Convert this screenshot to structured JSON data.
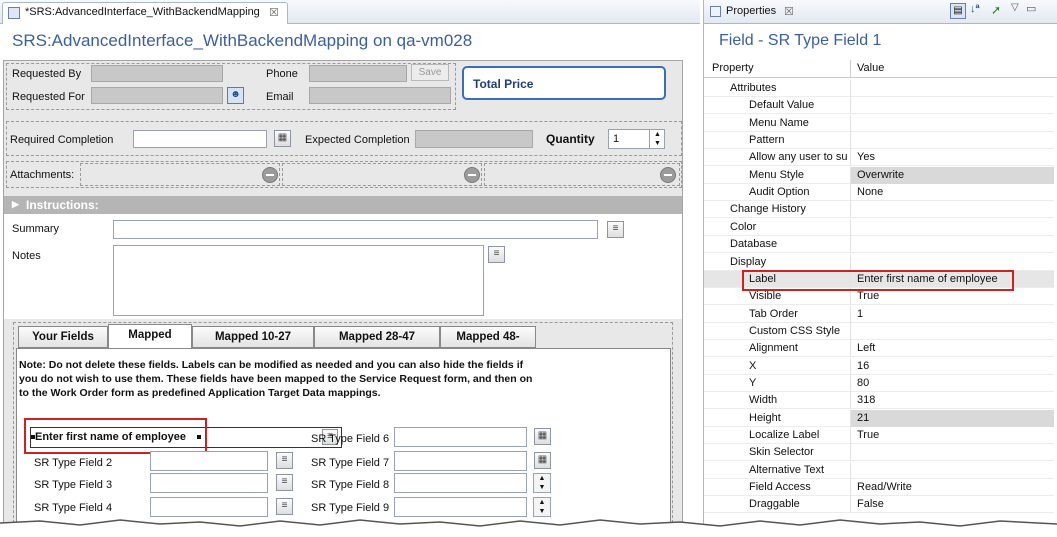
{
  "editor": {
    "tab_title": "*SRS:AdvancedInterface_WithBackendMapping",
    "page_title": "SRS:AdvancedInterface_WithBackendMapping on qa-vm028"
  },
  "form": {
    "requested_by_label": "Requested By",
    "requested_for_label": "Requested For",
    "phone_label": "Phone",
    "email_label": "Email",
    "save_label": "Save",
    "total_price_label": "Total Price",
    "required_completion_label": "Required Completion",
    "expected_completion_label": "Expected Completion",
    "quantity_label": "Quantity",
    "quantity_value": "1",
    "attachments_label": "Attachments:",
    "instructions_label": "Instructions:",
    "summary_label": "Summary",
    "notes_label": "Notes",
    "tabs": [
      "Your Fields",
      "Mapped",
      "Mapped 10-27",
      "Mapped 28-47",
      "Mapped 48-"
    ],
    "note": "Note: Do not delete these fields. Labels can be modified as needed and you can also hide the fields if you do not wish to use them.  These fields have been mapped to the Service Request form, and then on to the Work Order form as predefined Application Target Data mappings.",
    "selected_field_label": "Enter first name of employee",
    "left_fields": [
      "SR Type Field 2",
      "SR Type Field 3",
      "SR Type Field 4"
    ],
    "right_fields": [
      "SR Type Field 6",
      "SR Type Field 7",
      "SR Type Field 8",
      "SR Type Field 9"
    ]
  },
  "properties": {
    "tab_title": "Properties",
    "heading": "Field - SR Type Field 1",
    "col_property": "Property",
    "col_value": "Value",
    "rows": [
      {
        "name": "Attributes",
        "value": "",
        "indent": 1
      },
      {
        "name": "Default Value",
        "value": "",
        "indent": 2
      },
      {
        "name": "Menu Name",
        "value": "",
        "indent": 2
      },
      {
        "name": "Pattern",
        "value": "",
        "indent": 2
      },
      {
        "name": "Allow any user to su",
        "value": "Yes",
        "indent": 2
      },
      {
        "name": "Menu Style",
        "value": "Overwrite",
        "indent": 2,
        "shaded": true
      },
      {
        "name": "Audit Option",
        "value": "None",
        "indent": 2
      },
      {
        "name": "Change History",
        "value": "",
        "indent": 1
      },
      {
        "name": "Color",
        "value": "",
        "indent": 1
      },
      {
        "name": "Database",
        "value": "",
        "indent": 1
      },
      {
        "name": "Display",
        "value": "",
        "indent": 1
      },
      {
        "name": "Label",
        "value": "Enter first name of employee",
        "indent": 2,
        "selected": true
      },
      {
        "name": "Visible",
        "value": "True",
        "indent": 2
      },
      {
        "name": "Tab Order",
        "value": "1",
        "indent": 2
      },
      {
        "name": "Custom CSS Style",
        "value": "",
        "indent": 2
      },
      {
        "name": "Alignment",
        "value": "Left",
        "indent": 2
      },
      {
        "name": "X",
        "value": "16",
        "indent": 2
      },
      {
        "name": "Y",
        "value": "80",
        "indent": 2
      },
      {
        "name": "Width",
        "value": "318",
        "indent": 2
      },
      {
        "name": "Height",
        "value": "21",
        "indent": 2,
        "shaded": true
      },
      {
        "name": "Localize Label",
        "value": "True",
        "indent": 2
      },
      {
        "name": "Skin Selector",
        "value": "",
        "indent": 2
      },
      {
        "name": "Alternative Text",
        "value": "",
        "indent": 2
      },
      {
        "name": "Field Access",
        "value": "Read/Write",
        "indent": 2
      },
      {
        "name": "Draggable",
        "value": "False",
        "indent": 2
      }
    ]
  },
  "colors": {
    "accent_title": "#3a5fa0",
    "highlight": "#d12020"
  }
}
